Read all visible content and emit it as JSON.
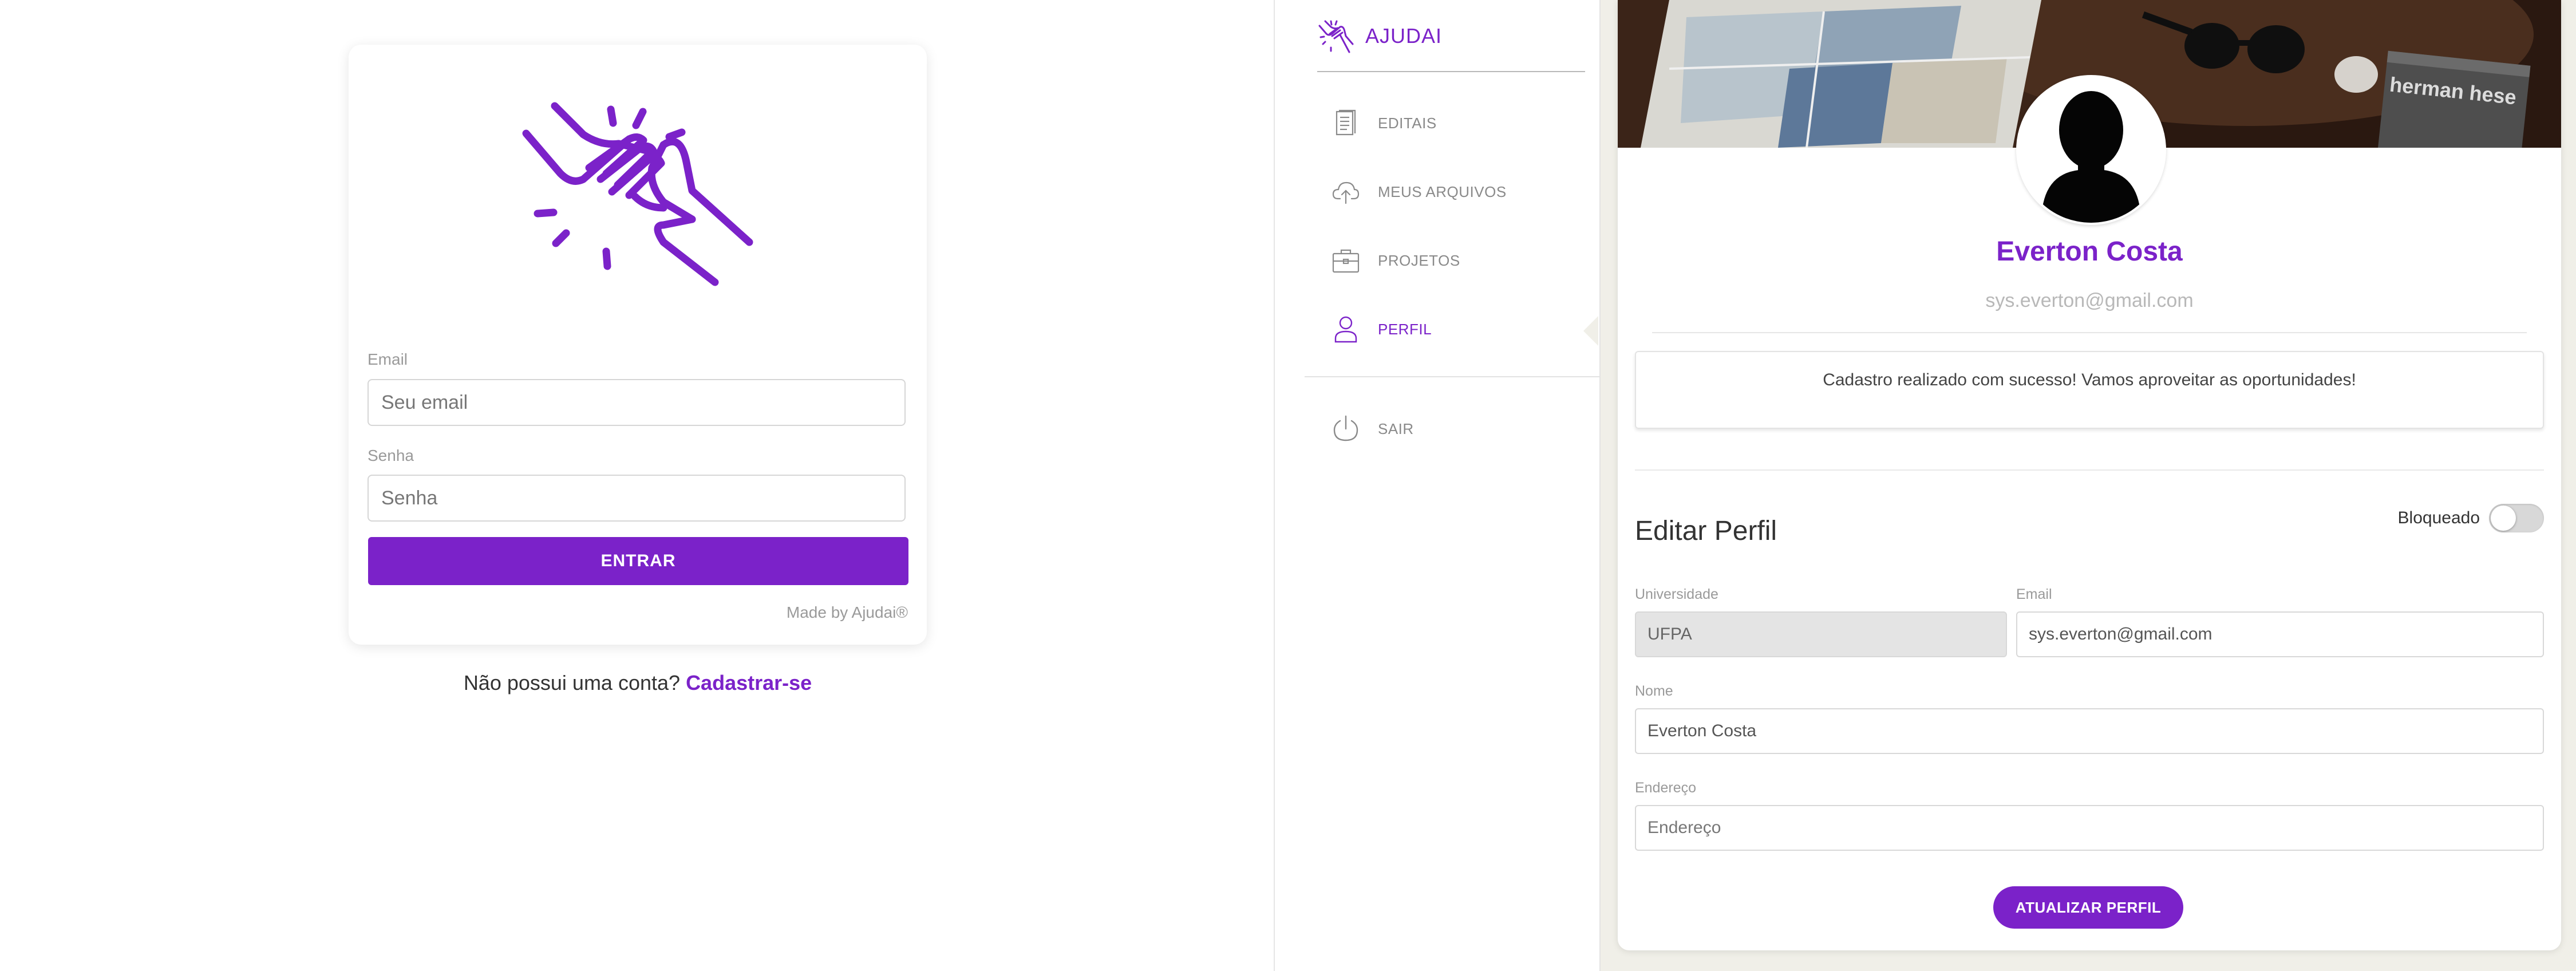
{
  "login": {
    "email_label": "Email",
    "email_placeholder": "Seu email",
    "password_label": "Senha",
    "password_placeholder": "Senha",
    "submit_label": "ENTRAR",
    "made_by": "Made by Ajudai®",
    "signup_prompt": "Não possui uma conta?",
    "signup_link": "Cadastrar-se"
  },
  "sidebar": {
    "brand": "AJUDAI",
    "items": [
      {
        "label": "EDITAIS",
        "icon": "document-list-icon"
      },
      {
        "label": "MEUS ARQUIVOS",
        "icon": "cloud-upload-icon"
      },
      {
        "label": "PROJETOS",
        "icon": "briefcase-icon"
      },
      {
        "label": "PERFIL",
        "icon": "user-icon",
        "active": true
      },
      {
        "label": "SAIR",
        "icon": "power-icon"
      }
    ]
  },
  "profile": {
    "name": "Everton Costa",
    "email": "sys.everton@gmail.com",
    "alert": "Cadastro realizado com sucesso! Vamos aproveitar as oportunidades!",
    "section_title": "Editar Perfil",
    "blocked_label": "Bloqueado",
    "blocked": false,
    "form": {
      "university_label": "Universidade",
      "university_value": "UFPA",
      "email_label": "Email",
      "email_value": "sys.everton@gmail.com",
      "name_label": "Nome",
      "name_value": "Everton Costa",
      "address_label": "Endereço",
      "address_placeholder": "Endereço"
    },
    "update_button": "ATUALIZAR PERFIL",
    "cover_book_text": "herman hese"
  },
  "colors": {
    "accent": "#7b22c9",
    "panel_bg": "#f0efe8"
  }
}
